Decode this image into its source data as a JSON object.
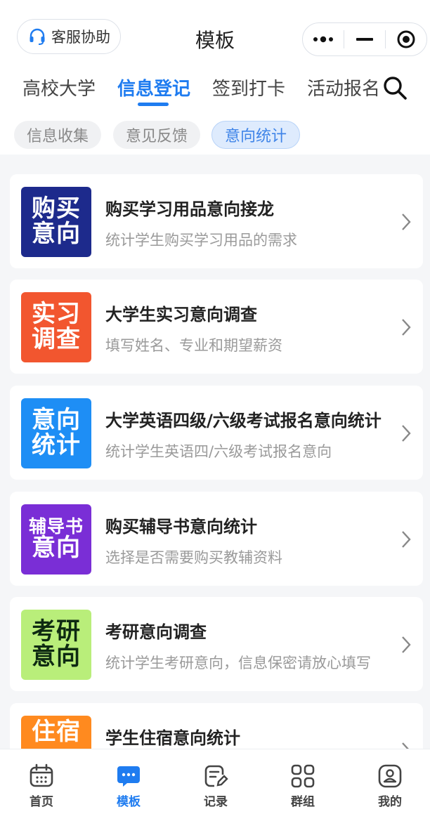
{
  "header": {
    "customer_service_label": "客服协助",
    "page_title": "模板"
  },
  "category_tabs": [
    {
      "label": "高校大学",
      "active": false
    },
    {
      "label": "信息登记",
      "active": true
    },
    {
      "label": "签到打卡",
      "active": false
    },
    {
      "label": "活动报名",
      "active": false
    }
  ],
  "sub_chips": [
    {
      "label": "信息收集",
      "active": false
    },
    {
      "label": "意见反馈",
      "active": false
    },
    {
      "label": "意向统计",
      "active": true
    }
  ],
  "templates": [
    {
      "thumb_line1": "购买",
      "thumb_line2": "意向",
      "thumb_color": "#1d2a8c",
      "title": "购买学习用品意向接龙",
      "desc": "统计学生购买学习用品的需求"
    },
    {
      "thumb_line1": "实习",
      "thumb_line2": "调查",
      "thumb_color": "#f2562f",
      "title": "大学生实习意向调查",
      "desc": "填写姓名、专业和期望薪资"
    },
    {
      "thumb_line1": "意向",
      "thumb_line2": "统计",
      "thumb_color": "#1e8ef5",
      "title": "大学英语四级/六级考试报名意向统计",
      "desc": "统计学生英语四/六级考试报名意向"
    },
    {
      "thumb_line1": "辅导书",
      "thumb_line2": "意向",
      "thumb_color": "#7a2ed6",
      "title": "购买辅导书意向统计",
      "desc": "选择是否需要购买教辅资料"
    },
    {
      "thumb_line1": "考研",
      "thumb_line2": "意向",
      "thumb_color": "#b9ee7a",
      "title": "考研意向调查",
      "desc": "统计学生考研意向，信息保密请放心填写"
    },
    {
      "thumb_line1": "住宿",
      "thumb_line2": "",
      "thumb_color": "#ff8a1f",
      "title": "学生住宿意向统计",
      "desc": ""
    }
  ],
  "bottom_nav": [
    {
      "label": "首页",
      "icon": "calendar-icon",
      "active": false
    },
    {
      "label": "模板",
      "icon": "chat-bubble-icon",
      "active": true
    },
    {
      "label": "记录",
      "icon": "edit-note-icon",
      "active": false
    },
    {
      "label": "群组",
      "icon": "grid-icon",
      "active": false
    },
    {
      "label": "我的",
      "icon": "profile-icon",
      "active": false
    }
  ],
  "colors": {
    "accent": "#1f7cf0",
    "background": "#f5f6f8"
  }
}
